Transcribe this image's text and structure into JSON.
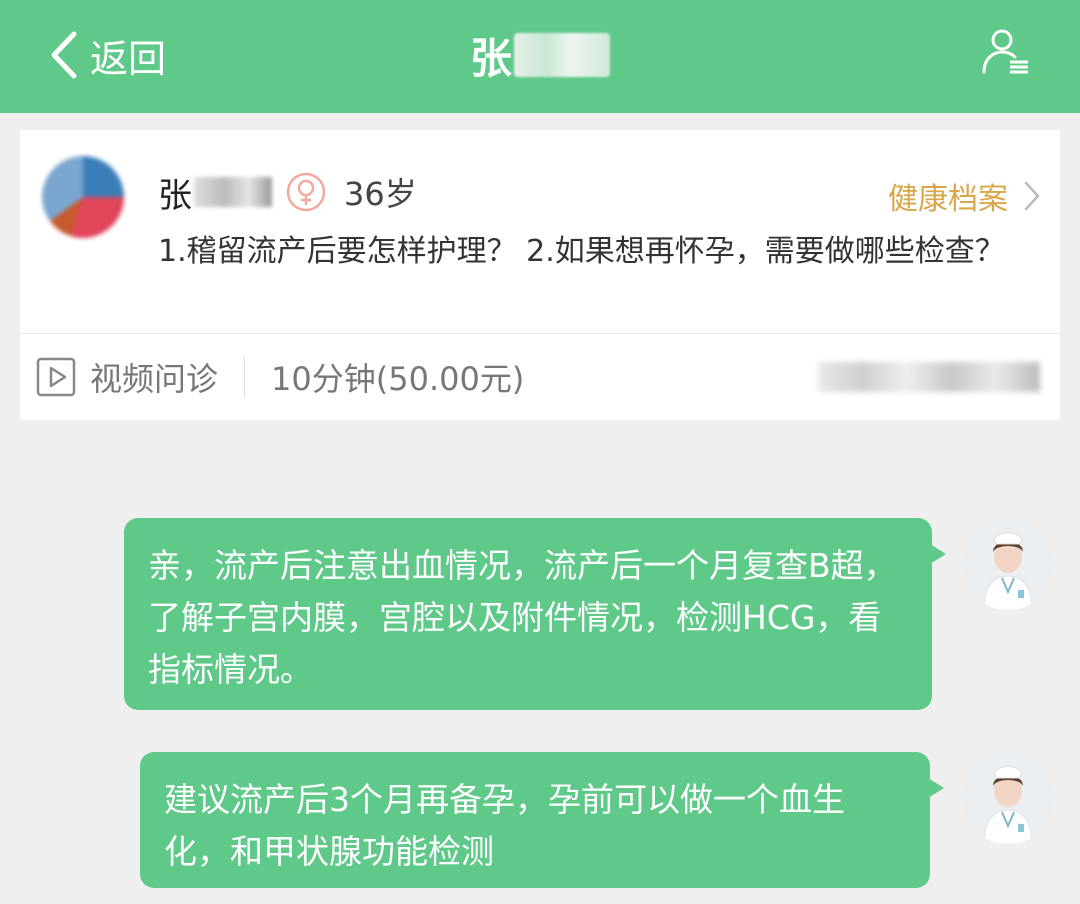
{
  "header": {
    "back_label": "返回",
    "title": "张",
    "icons": {
      "back": "chevron-left-icon",
      "profile": "user-menu-icon"
    }
  },
  "patient": {
    "name": "张",
    "gender_icon": "female-icon",
    "age": "36岁",
    "health_record_label": "健康档案",
    "question": "1.稽留流产后要怎样护理？ 2.如果想再怀孕，需要做哪些检查？",
    "service_type": "视频问诊",
    "service_price": "10分钟(50.00元)"
  },
  "messages": [
    {
      "sender": "doctor",
      "text": "亲，流产后注意出血情况，流产后一个月复查B超，了解子宫内膜，宫腔以及附件情况，检测HCG，看指标情况。"
    },
    {
      "sender": "doctor",
      "text": "建议流产后3个月再备孕，孕前可以做一个血生化，和甲状腺功能检测"
    }
  ],
  "colors": {
    "brand_green": "#5fc98a",
    "health_link": "#d9a74a",
    "female_pink": "#f2a9a0"
  }
}
